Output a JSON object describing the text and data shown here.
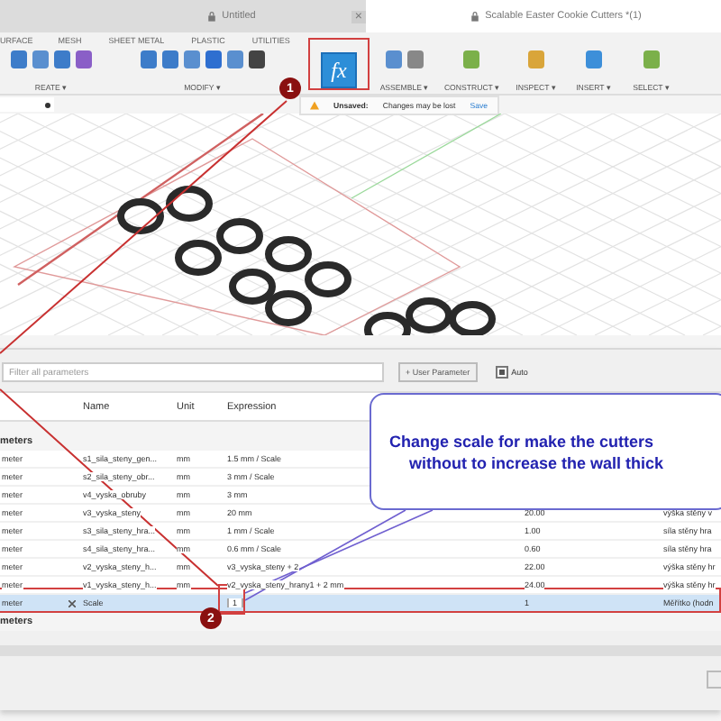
{
  "tabs": [
    {
      "label": "Untitled",
      "selected": false
    },
    {
      "label": "Scalable Easter Cookie Cutters *(1)",
      "selected": true
    }
  ],
  "tab_close": "×",
  "toolbar": {
    "sections": [
      "URFACE",
      "MESH",
      "SHEET METAL",
      "PLASTIC",
      "UTILITIES"
    ],
    "parameters_icon": "fx",
    "groups": [
      "REATE ▾",
      "MODIFY ▾",
      "ASSEMBLE ▾",
      "CONSTRUCT ▾",
      "INSPECT ▾",
      "INSERT ▾",
      "SELECT ▾"
    ]
  },
  "notice": {
    "title": "Unsaved:",
    "message": "Changes may be lost",
    "action": "Save"
  },
  "dialog": {
    "filter": {
      "placeholder": "Filter all parameters"
    },
    "add_button": "+ User Parameter",
    "auto": {
      "label": "Auto",
      "checked": true
    },
    "columns": [
      "Name",
      "Unit",
      "Expression"
    ],
    "rows": [
      {
        "kind": "group",
        "label": "meters"
      },
      {
        "kind": "param",
        "type": "meter",
        "favorite": false,
        "name": "s1_sila_steny_gen...",
        "unit": "mm",
        "expression": "1.5 mm / Scale",
        "selected": false
      },
      {
        "kind": "param",
        "type": "meter",
        "favorite": false,
        "name": "s2_sila_steny_obr...",
        "unit": "mm",
        "expression": "3 mm / Scale",
        "selected": false
      },
      {
        "kind": "param",
        "type": "meter",
        "favorite": false,
        "name": "v4_vyska_obruby",
        "unit": "mm",
        "expression": "3 mm",
        "selected": false
      },
      {
        "kind": "param",
        "type": "meter",
        "favorite": false,
        "name": "v3_vyska_steny",
        "unit": "mm",
        "expression": "20 mm",
        "value": "20.00",
        "comment": "výška stěny v",
        "selected": false
      },
      {
        "kind": "param",
        "type": "meter",
        "favorite": false,
        "name": "s3_sila_steny_hra...",
        "unit": "mm",
        "expression": "1 mm / Scale",
        "value": "1.00",
        "comment": "síla stěny hra",
        "selected": false
      },
      {
        "kind": "param",
        "type": "meter",
        "favorite": false,
        "name": "s4_sila_steny_hra...",
        "unit": "mm",
        "expression": "0.6 mm / Scale",
        "value": "0.60",
        "comment": "síla stěny hra",
        "selected": false
      },
      {
        "kind": "param",
        "type": "meter",
        "favorite": false,
        "name": "v2_vyska_steny_h...",
        "unit": "mm",
        "expression": "v3_vyska_steny + 2",
        "value": "22.00",
        "comment": "výška stěny hr",
        "selected": false
      },
      {
        "kind": "param",
        "type": "meter",
        "favorite": false,
        "name": "v1_vyska_steny_h...",
        "unit": "mm",
        "expression": "v2_vyska_steny_hrany1 + 2 mm",
        "value": "24.00",
        "comment": "výška stěny hr",
        "selected": false
      },
      {
        "kind": "param",
        "type": "meter",
        "favorite": true,
        "name": "Scale",
        "unit": "",
        "expression": "1",
        "value": "1",
        "comment": "Měřítko (hodn",
        "selected": true
      },
      {
        "kind": "group",
        "label": "meters"
      }
    ]
  },
  "annotations": {
    "markers": [
      "1",
      "2"
    ],
    "callout": [
      "Change scale for make the cutters",
      "without to increase the wall thick"
    ]
  }
}
